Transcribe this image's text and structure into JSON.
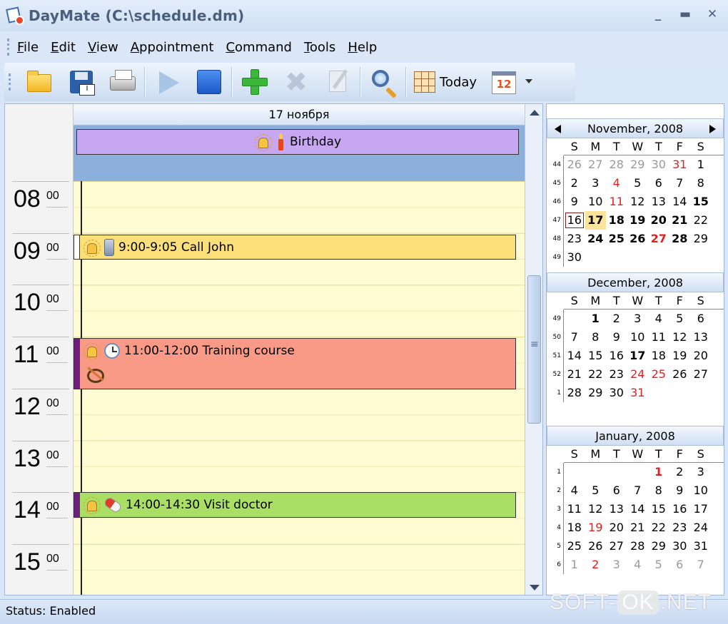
{
  "window": {
    "title": "DayMate (C:\\schedule.dm)",
    "minimize": "_",
    "maximize": "▬",
    "close": "✕"
  },
  "menu": [
    "File",
    "Edit",
    "View",
    "Appointment",
    "Command",
    "Tools",
    "Help"
  ],
  "toolbar": {
    "today_label": "Today",
    "calendar_icon_day": "12"
  },
  "day_view": {
    "date_header": "17 ноября",
    "all_day_event": "Birthday",
    "hours": [
      {
        "h": "08",
        "m": "00"
      },
      {
        "h": "09",
        "m": "00"
      },
      {
        "h": "10",
        "m": "00"
      },
      {
        "h": "11",
        "m": "00"
      },
      {
        "h": "12",
        "m": "00"
      },
      {
        "h": "13",
        "m": "00"
      },
      {
        "h": "14",
        "m": "00"
      },
      {
        "h": "15",
        "m": "00"
      }
    ],
    "appointments": [
      {
        "label": "9:00-9:05 Call John",
        "color": "#fbe07a"
      },
      {
        "label": "11:00-12:00 Training course",
        "color": "#f89a86"
      },
      {
        "label": "14:00-14:30 Visit doctor",
        "color": "#a8df64"
      }
    ]
  },
  "calendars": [
    {
      "title": "November, 2008",
      "dow": [
        "S",
        "M",
        "T",
        "W",
        "T",
        "F",
        "S"
      ],
      "weeks": [
        {
          "wk": "44",
          "days": [
            [
              "26",
              "gray"
            ],
            [
              "27",
              "gray"
            ],
            [
              "28",
              "gray"
            ],
            [
              "29",
              "gray"
            ],
            [
              "30",
              "gray"
            ],
            [
              "31",
              "red"
            ],
            [
              "1",
              ""
            ]
          ]
        },
        {
          "wk": "45",
          "days": [
            [
              "2",
              ""
            ],
            [
              "3",
              ""
            ],
            [
              "4",
              "red"
            ],
            [
              "5",
              ""
            ],
            [
              "6",
              ""
            ],
            [
              "7",
              ""
            ],
            [
              "8",
              ""
            ]
          ]
        },
        {
          "wk": "46",
          "days": [
            [
              "9",
              ""
            ],
            [
              "10",
              ""
            ],
            [
              "11",
              "red"
            ],
            [
              "12",
              ""
            ],
            [
              "13",
              ""
            ],
            [
              "14",
              ""
            ],
            [
              "15",
              "b"
            ]
          ]
        },
        {
          "wk": "47",
          "days": [
            [
              "16",
              "today-box"
            ],
            [
              "17",
              "b sel"
            ],
            [
              "18",
              "b"
            ],
            [
              "19",
              "b"
            ],
            [
              "20",
              "b"
            ],
            [
              "21",
              "b"
            ],
            [
              "22",
              ""
            ]
          ]
        },
        {
          "wk": "48",
          "days": [
            [
              "23",
              ""
            ],
            [
              "24",
              "b"
            ],
            [
              "25",
              "b"
            ],
            [
              "26",
              "b"
            ],
            [
              "27",
              "b red"
            ],
            [
              "28",
              "b"
            ],
            [
              "29",
              ""
            ]
          ]
        },
        {
          "wk": "49",
          "days": [
            [
              "30",
              ""
            ]
          ]
        }
      ]
    },
    {
      "title": "December, 2008",
      "dow": [
        "S",
        "M",
        "T",
        "W",
        "T",
        "F",
        "S"
      ],
      "weeks": [
        {
          "wk": "49",
          "days": [
            [
              "",
              ""
            ],
            [
              "1",
              "b"
            ],
            [
              "2",
              ""
            ],
            [
              "3",
              ""
            ],
            [
              "4",
              ""
            ],
            [
              "5",
              ""
            ],
            [
              "6",
              ""
            ]
          ]
        },
        {
          "wk": "50",
          "days": [
            [
              "7",
              ""
            ],
            [
              "8",
              ""
            ],
            [
              "9",
              ""
            ],
            [
              "10",
              ""
            ],
            [
              "11",
              ""
            ],
            [
              "12",
              ""
            ],
            [
              "13",
              ""
            ]
          ]
        },
        {
          "wk": "51",
          "days": [
            [
              "14",
              ""
            ],
            [
              "15",
              ""
            ],
            [
              "16",
              ""
            ],
            [
              "17",
              "b"
            ],
            [
              "18",
              ""
            ],
            [
              "19",
              ""
            ],
            [
              "20",
              ""
            ]
          ]
        },
        {
          "wk": "52",
          "days": [
            [
              "21",
              ""
            ],
            [
              "22",
              ""
            ],
            [
              "23",
              ""
            ],
            [
              "24",
              "red"
            ],
            [
              "25",
              "red"
            ],
            [
              "26",
              ""
            ],
            [
              "27",
              ""
            ]
          ]
        },
        {
          "wk": "1",
          "days": [
            [
              "28",
              ""
            ],
            [
              "29",
              ""
            ],
            [
              "30",
              ""
            ],
            [
              "31",
              "red"
            ]
          ]
        }
      ]
    },
    {
      "title": "January, 2008",
      "dow": [
        "S",
        "M",
        "T",
        "W",
        "T",
        "F",
        "S"
      ],
      "weeks": [
        {
          "wk": "1",
          "days": [
            [
              "",
              ""
            ],
            [
              "",
              ""
            ],
            [
              "",
              ""
            ],
            [
              "",
              ""
            ],
            [
              "1",
              "b red"
            ],
            [
              "2",
              ""
            ],
            [
              "3",
              ""
            ]
          ]
        },
        {
          "wk": "2",
          "days": [
            [
              "4",
              ""
            ],
            [
              "5",
              ""
            ],
            [
              "6",
              ""
            ],
            [
              "7",
              ""
            ],
            [
              "8",
              ""
            ],
            [
              "9",
              ""
            ],
            [
              "10",
              ""
            ]
          ]
        },
        {
          "wk": "3",
          "days": [
            [
              "11",
              ""
            ],
            [
              "12",
              ""
            ],
            [
              "13",
              ""
            ],
            [
              "14",
              ""
            ],
            [
              "15",
              ""
            ],
            [
              "16",
              ""
            ],
            [
              "17",
              ""
            ]
          ]
        },
        {
          "wk": "4",
          "days": [
            [
              "18",
              ""
            ],
            [
              "19",
              "red"
            ],
            [
              "20",
              ""
            ],
            [
              "21",
              ""
            ],
            [
              "22",
              ""
            ],
            [
              "23",
              ""
            ],
            [
              "24",
              ""
            ]
          ]
        },
        {
          "wk": "5",
          "days": [
            [
              "25",
              ""
            ],
            [
              "26",
              ""
            ],
            [
              "27",
              ""
            ],
            [
              "28",
              ""
            ],
            [
              "29",
              ""
            ],
            [
              "30",
              ""
            ],
            [
              "31",
              ""
            ]
          ]
        },
        {
          "wk": "6",
          "days": [
            [
              "1",
              "gray"
            ],
            [
              "2",
              "red"
            ],
            [
              "3",
              "gray"
            ],
            [
              "4",
              "gray"
            ],
            [
              "5",
              "gray"
            ],
            [
              "6",
              "gray"
            ],
            [
              "7",
              "gray"
            ]
          ]
        }
      ]
    }
  ],
  "status": {
    "text": "Status: Enabled"
  },
  "watermark": {
    "left": "SOFT-",
    "mid": "OK",
    "right": ".NET"
  }
}
